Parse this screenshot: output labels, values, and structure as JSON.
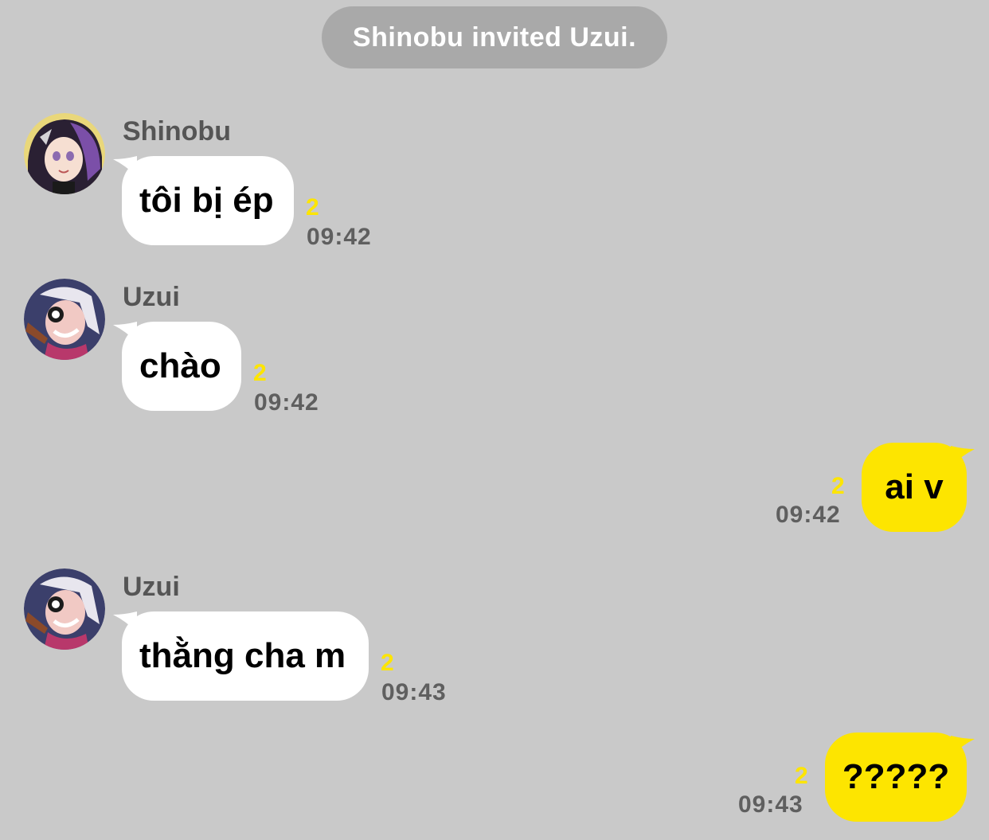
{
  "system_message": "Shinobu invited Uzui.",
  "messages": [
    {
      "sender": "Shinobu",
      "text": "tôi bị ép",
      "unread": "2",
      "time": "09:42"
    },
    {
      "sender": "Uzui",
      "text": "chào",
      "unread": "2",
      "time": "09:42"
    },
    {
      "sender": "",
      "text": "ai v",
      "unread": "2",
      "time": "09:42"
    },
    {
      "sender": "Uzui",
      "text": "thằng cha m",
      "unread": "2",
      "time": "09:43"
    },
    {
      "sender": "",
      "text": "?????",
      "unread": "2",
      "time": "09:43"
    }
  ],
  "colors": {
    "background": "#c9c9c9",
    "incoming_bubble": "#ffffff",
    "outgoing_bubble": "#fde500",
    "unread_count": "#fde500",
    "system_pill": "#a9a9a9"
  },
  "icons": {
    "shinobu_avatar": "avatar-shinobu",
    "uzui_avatar": "avatar-uzui"
  }
}
